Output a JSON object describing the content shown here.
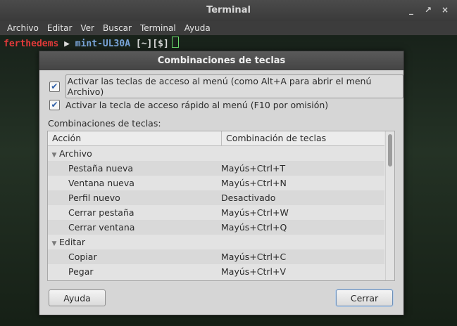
{
  "terminal": {
    "title": "Terminal",
    "window_buttons": [
      "_",
      "↗",
      "×"
    ],
    "menu": [
      "Archivo",
      "Editar",
      "Ver",
      "Buscar",
      "Terminal",
      "Ayuda"
    ],
    "prompt": {
      "user": "ferthedems",
      "arrow": "▶",
      "host": "mint-UL30A",
      "dir": "[~][$]"
    }
  },
  "dialog": {
    "title": "Combinaciones de teclas",
    "check1": {
      "label": "Activar las teclas de acceso al menú (como Alt+A para abrir el menú Archivo)",
      "checked": true
    },
    "check2": {
      "label": "Activar la tecla de acceso rápido al menú (F10 por omisión)",
      "checked": true
    },
    "section_label": "Combinaciones de teclas:",
    "columns": [
      "Acción",
      "Combinación de teclas"
    ],
    "rows": [
      {
        "type": "group",
        "action": "Archivo",
        "shortcut": ""
      },
      {
        "type": "child",
        "action": "Pestaña nueva",
        "shortcut": "Mayús+Ctrl+T"
      },
      {
        "type": "child",
        "action": "Ventana nueva",
        "shortcut": "Mayús+Ctrl+N"
      },
      {
        "type": "child",
        "action": "Perfil nuevo",
        "shortcut": "Desactivado"
      },
      {
        "type": "child",
        "action": "Cerrar pestaña",
        "shortcut": "Mayús+Ctrl+W"
      },
      {
        "type": "child",
        "action": "Cerrar ventana",
        "shortcut": "Mayús+Ctrl+Q"
      },
      {
        "type": "group",
        "action": "Editar",
        "shortcut": ""
      },
      {
        "type": "child",
        "action": "Copiar",
        "shortcut": "Mayús+Ctrl+C"
      },
      {
        "type": "child",
        "action": "Pegar",
        "shortcut": "Mayús+Ctrl+V"
      }
    ],
    "help_button": "Ayuda",
    "close_button": "Cerrar"
  }
}
